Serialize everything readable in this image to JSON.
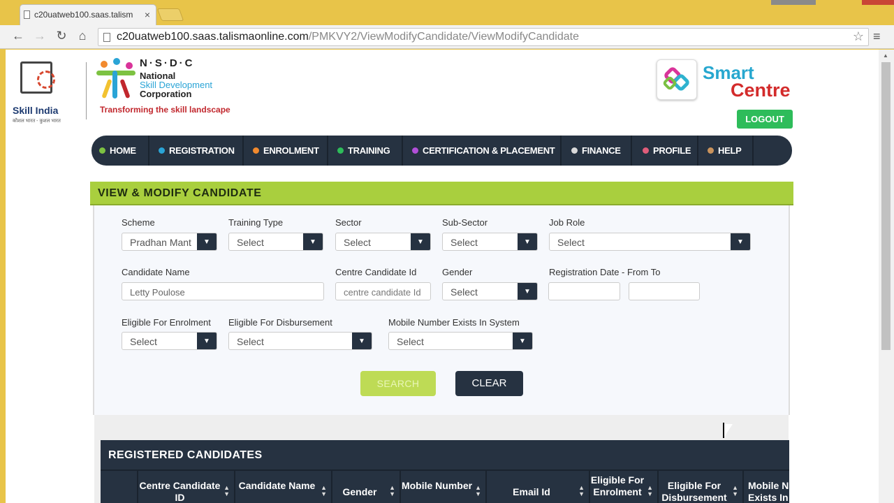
{
  "browser": {
    "tab_title": "c20uatweb100.saas.talism",
    "tab_close": "×",
    "url_host": "c20uatweb100.saas.talismaonline.com",
    "url_path": "/PMKVY2/ViewModifyCandidate/ViewModifyCandidate",
    "back": "←",
    "forward": "→",
    "reload": "↻",
    "home": "⌂",
    "star": "☆",
    "menu": "≡"
  },
  "header": {
    "skill_india_title": "Skill India",
    "skill_india_sub": "कौशल भारत - कुशल भारत",
    "nsdc_title": "N·S·D·C",
    "nsdc_line1": "National",
    "nsdc_line2": "Skill Development",
    "nsdc_line3": "Corporation",
    "nsdc_tagline": "Transforming the skill landscape",
    "smart": "Smart",
    "centre": "Centre",
    "logout": "LOGOUT"
  },
  "nav": [
    {
      "label": "HOME",
      "color": "#7dc242"
    },
    {
      "label": "REGISTRATION",
      "color": "#2aa4d6"
    },
    {
      "label": "ENROLMENT",
      "color": "#f28a2e"
    },
    {
      "label": "TRAINING",
      "color": "#2ebc5a"
    },
    {
      "label": "CERTIFICATION & PLACEMENT",
      "color": "#b14fd8"
    },
    {
      "label": "FINANCE",
      "color": "#d9d9d9"
    },
    {
      "label": "PROFILE",
      "color": "#e05d7a"
    },
    {
      "label": "HELP",
      "color": "#c9935c"
    }
  ],
  "panel": {
    "title": "VIEW & MODIFY CANDIDATE",
    "scheme_label": "Scheme",
    "scheme_value": "Pradhan Mant",
    "training_type_label": "Training Type",
    "training_type_value": "Select",
    "sector_label": "Sector",
    "sector_value": "Select",
    "sub_sector_label": "Sub-Sector",
    "sub_sector_value": "Select",
    "job_role_label": "Job Role",
    "job_role_value": "Select",
    "candidate_name_label": "Candidate Name",
    "candidate_name_value": "Letty Poulose",
    "centre_candidate_id_label": "Centre Candidate Id",
    "centre_candidate_id_placeholder": "centre candidate Id",
    "gender_label": "Gender",
    "gender_value": "Select",
    "reg_date_label": "Registration Date - From To",
    "reg_from_value": "",
    "reg_to_value": "",
    "eligible_enrolment_label": "Eligible For Enrolment",
    "eligible_enrolment_value": "Select",
    "eligible_disbursement_label": "Eligible For Disbursement",
    "eligible_disbursement_value": "Select",
    "mobile_exists_label": "Mobile Number Exists In System",
    "mobile_exists_value": "Select",
    "search_label": "SEARCH",
    "clear_label": "CLEAR"
  },
  "registered": {
    "title": "REGISTERED CANDIDATES",
    "columns": [
      "",
      "Centre Candidate ID",
      "Candidate Name",
      "Gender",
      "Mobile Number",
      "Email Id",
      "Eligible For Enrolment",
      "Eligible For Disbursement",
      "Mobile Number Exists In System"
    ]
  }
}
